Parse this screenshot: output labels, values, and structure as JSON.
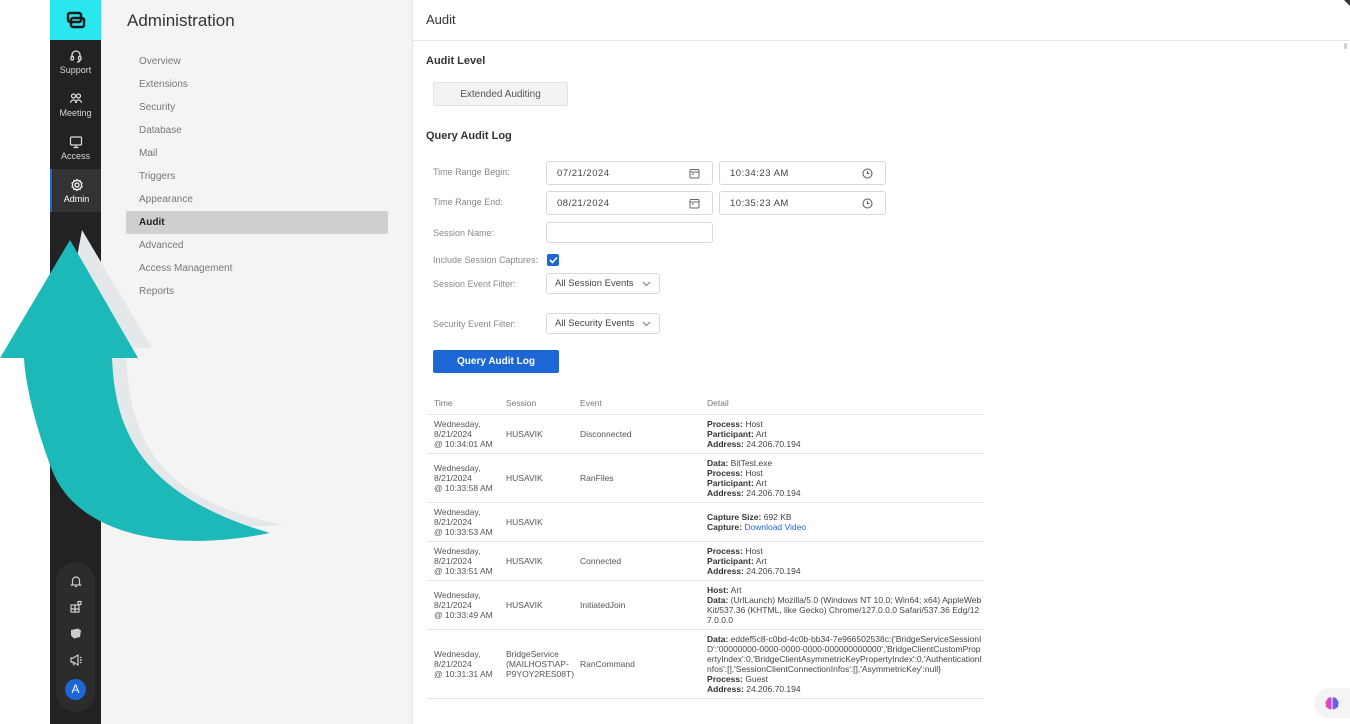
{
  "rail": {
    "logo_icon": "app-logo-icon",
    "items": [
      {
        "label": "Support",
        "icon": "headset-icon"
      },
      {
        "label": "Meeting",
        "icon": "people-icon"
      },
      {
        "label": "Access",
        "icon": "monitor-icon"
      },
      {
        "label": "Admin",
        "icon": "gear-icon",
        "active": true
      }
    ],
    "bottom_icons": [
      "bell-icon",
      "extensions-icon",
      "box-icon",
      "megaphone-icon"
    ],
    "avatar_letter": "A"
  },
  "nav": {
    "title": "Administration",
    "items": [
      {
        "label": "Overview"
      },
      {
        "label": "Extensions"
      },
      {
        "label": "Security"
      },
      {
        "label": "Database"
      },
      {
        "label": "Mail"
      },
      {
        "label": "Triggers"
      },
      {
        "label": "Appearance"
      },
      {
        "label": "Audit",
        "active": true
      },
      {
        "label": "Advanced"
      },
      {
        "label": "Access Management"
      },
      {
        "label": "Reports"
      }
    ]
  },
  "main": {
    "header": "Audit",
    "audit_level": {
      "title": "Audit Level",
      "button": "Extended Auditing"
    },
    "query": {
      "title": "Query Audit Log",
      "time_begin_label": "Time Range Begin:",
      "time_begin_date": "07/21/2024",
      "time_begin_time": "10:34:23 AM",
      "time_end_label": "Time Range End:",
      "time_end_date": "08/21/2024",
      "time_end_time": "10:35:23 AM",
      "session_name_label": "Session Name:",
      "session_name_value": "",
      "include_captures_label": "Include Session Captures:",
      "include_captures_checked": true,
      "session_filter_label": "Session Event Filter:",
      "session_filter_value": "All Session Events",
      "security_filter_label": "Security Event Filter:",
      "security_filter_value": "All Security Events",
      "submit": "Query Audit Log"
    },
    "table": {
      "columns": [
        "Time",
        "Session",
        "Event",
        "Detail"
      ],
      "rows": [
        {
          "day": "Wednesday,",
          "date": "8/21/2024",
          "time": "@ 10:34:01 AM",
          "session": "HUSAVIK",
          "event": "Disconnected",
          "detail": [
            {
              "k": "Process:",
              "v": " Host"
            },
            {
              "k": "Participant:",
              "v": " Art"
            },
            {
              "k": "Address:",
              "v": " 24.206.70.194"
            }
          ]
        },
        {
          "day": "Wednesday,",
          "date": "8/21/2024",
          "time": "@ 10:33:58 AM",
          "session": "HUSAVIK",
          "event": "RanFiles",
          "detail": [
            {
              "k": "Data:",
              "v": " BitTest.exe"
            },
            {
              "k": "Process:",
              "v": " Host"
            },
            {
              "k": "Participant:",
              "v": " Art"
            },
            {
              "k": "Address:",
              "v": " 24.206.70.194"
            }
          ]
        },
        {
          "day": "Wednesday,",
          "date": "8/21/2024",
          "time": "@ 10:33:53 AM",
          "session": "HUSAVIK",
          "event": "",
          "detail": [
            {
              "k": "Capture Size:",
              "v": " 692 KB"
            },
            {
              "k": "Capture:",
              "v": " ",
              "link": "Download Video"
            }
          ]
        },
        {
          "day": "Wednesday,",
          "date": "8/21/2024",
          "time": "@ 10:33:51 AM",
          "session": "HUSAVIK",
          "event": "Connected",
          "detail": [
            {
              "k": "Process:",
              "v": " Host"
            },
            {
              "k": "Participant:",
              "v": " Art"
            },
            {
              "k": "Address:",
              "v": " 24.206.70.194"
            }
          ]
        },
        {
          "day": "Wednesday,",
          "date": "8/21/2024",
          "time": "@ 10:33:49 AM",
          "session": "HUSAVIK",
          "event": "InitiatedJoin",
          "detail": [
            {
              "k": "Host:",
              "v": " Art"
            },
            {
              "k": "Data:",
              "v": " (UrlLaunch) Mozilla/5.0 (Windows NT 10.0; Win64; x64) AppleWebKit/537.36 (KHTML, like Gecko) Chrome/127.0.0.0 Safari/537.36 Edg/127.0.0.0"
            }
          ]
        },
        {
          "day": "Wednesday,",
          "date": "8/21/2024",
          "time": "@ 10:31:31 AM",
          "session": "BridgeService (MAILHOST\\AP-P9YOY2RES08T)",
          "event": "RanCommand",
          "detail": [
            {
              "k": "Data:",
              "v": " eddef5c8-c0bd-4c0b-bb34-7e966502538c:{'BridgeServiceSessionID':'00000000-0000-0000-0000-000000000000','BridgeClientCustomPropertyIndex':0,'BridgeClientAsymmetricKeyPropertyIndex':0,'AuthenticationInfos':[],'SessionClientConnectionInfos':[],'AsymmetricKey':null}"
            },
            {
              "k": "Process:",
              "v": " Guest"
            },
            {
              "k": "Address:",
              "v": " 24.206.70.194"
            }
          ]
        }
      ]
    }
  },
  "overlay": {
    "arrow_color": "#1db8b8",
    "arrow_shadow_color": "#e4e8ea"
  },
  "ai_badge_icon": "brain-icon"
}
